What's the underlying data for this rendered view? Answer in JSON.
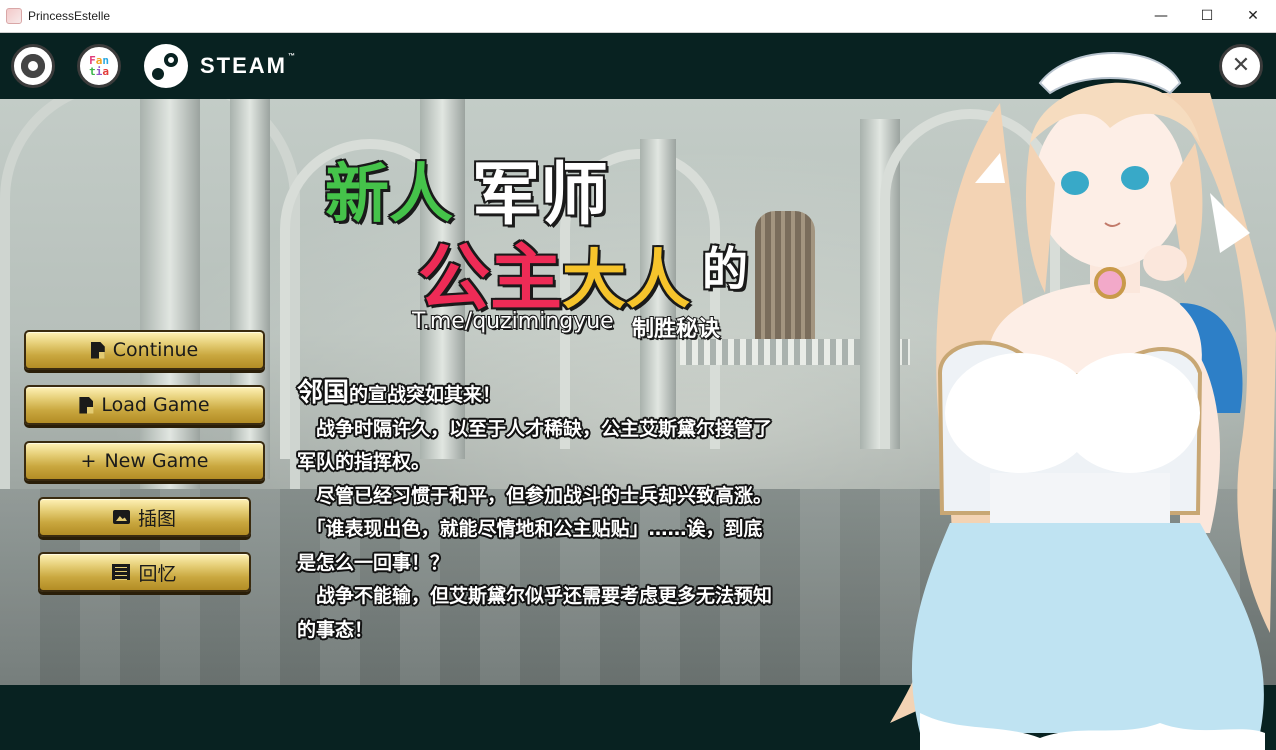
{
  "window": {
    "title": "PrincessEstelle",
    "minimize_glyph": "—",
    "maximize_glyph": "☐",
    "close_glyph": "✕"
  },
  "header": {
    "settings_icon": "gear-icon",
    "fantia_logo": [
      "F",
      "a",
      "n",
      "t",
      "i",
      "a"
    ],
    "steam_label": "STEAM",
    "steam_tm": "™",
    "close_glyph": "✕"
  },
  "title": {
    "line1a": "新人",
    "line1b": "军师",
    "line2a": "公主",
    "line2b": "大人",
    "line2c": "的",
    "line3a": "T.me/quzimingyue",
    "line3b": "制胜秘诀"
  },
  "menu": {
    "continue_label": "Continue",
    "load_label": "Load Game",
    "new_icon": "+",
    "new_label": "New Game",
    "gallery_label": "插图",
    "memory_label": "回忆"
  },
  "story": {
    "l1_big": "邻国",
    "l1_rest": "的宣战突如其来！",
    "l2": "　战争时隔许久，以至于人才稀缺，公主艾斯黛尔接管了",
    "l3": "军队的指挥权。",
    "l4": "　尽管已经习惯于和平，但参加战斗的士兵却兴致高涨。",
    "l5": "　「谁表现出色，就能尽情地和公主贴贴」……诶，到底",
    "l6": "是怎么一回事！？",
    "l7": "　战争不能输，但艾斯黛尔似乎还需要考虑更多无法预知",
    "l8": "的事态！"
  },
  "colors": {
    "bar_bg": "#082221",
    "button_gold": "#d9bd5a",
    "title_green": "#45c34a",
    "title_red": "#ee2b56",
    "title_yellow": "#f6c42c"
  }
}
